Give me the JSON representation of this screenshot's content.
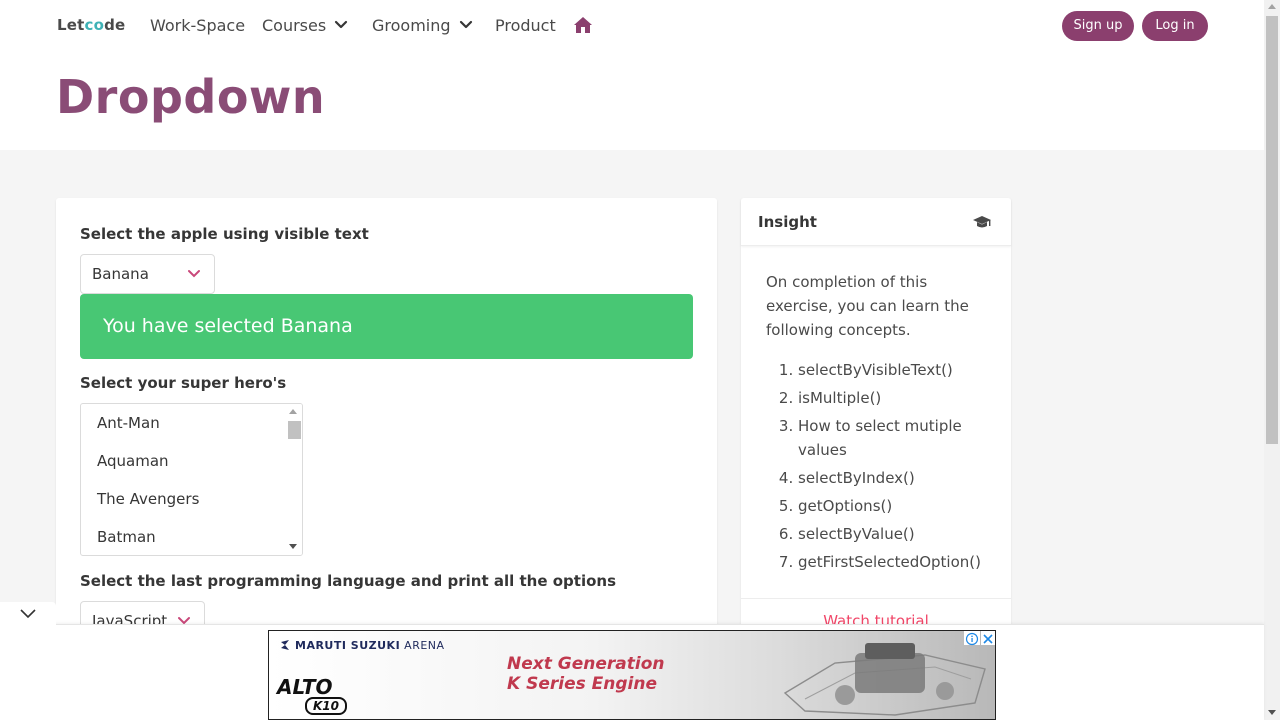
{
  "header": {
    "logo": {
      "pre": "Let",
      "mid": "c",
      "o": "o",
      "post": "de"
    },
    "nav": [
      {
        "label": "Work-Space",
        "dropdown": false
      },
      {
        "label": "Courses",
        "dropdown": true
      },
      {
        "label": "Grooming",
        "dropdown": true
      },
      {
        "label": "Product",
        "dropdown": false
      }
    ],
    "home_icon": "home-icon",
    "signup_label": "Sign up",
    "login_label": "Log in"
  },
  "page": {
    "title": "Dropdown"
  },
  "main": {
    "fruit": {
      "label": "Select the apple using visible text",
      "selected": "Banana",
      "result": "You have selected Banana"
    },
    "hero": {
      "label": "Select your super hero's",
      "options": [
        "Ant-Man",
        "Aquaman",
        "The Avengers",
        "Batman"
      ]
    },
    "language": {
      "label": "Select the last programming language and print all the options",
      "selected": "JavaScript"
    }
  },
  "insight": {
    "title": "Insight",
    "icon": "graduation-cap-icon",
    "intro": "On completion of this exercise, you can learn the following concepts.",
    "concepts": [
      "selectByVisibleText()",
      "isMultiple()",
      "How to select mutiple values",
      "selectByIndex()",
      "getOptions()",
      "selectByValue()",
      "getFirstSelectedOption()"
    ],
    "tutorial_label": "Watch tutorial"
  },
  "ad": {
    "brand": "MARUTI SUZUKI",
    "brand_sub": "ARENA",
    "headline_1": "Next Generation",
    "headline_2": "K Series Engine",
    "model": "ALTO",
    "model_sub": "K10"
  },
  "colors": {
    "brand": "#8b3f6e",
    "title": "#8a4c76",
    "success": "#48c774",
    "link_danger": "#f14668"
  }
}
